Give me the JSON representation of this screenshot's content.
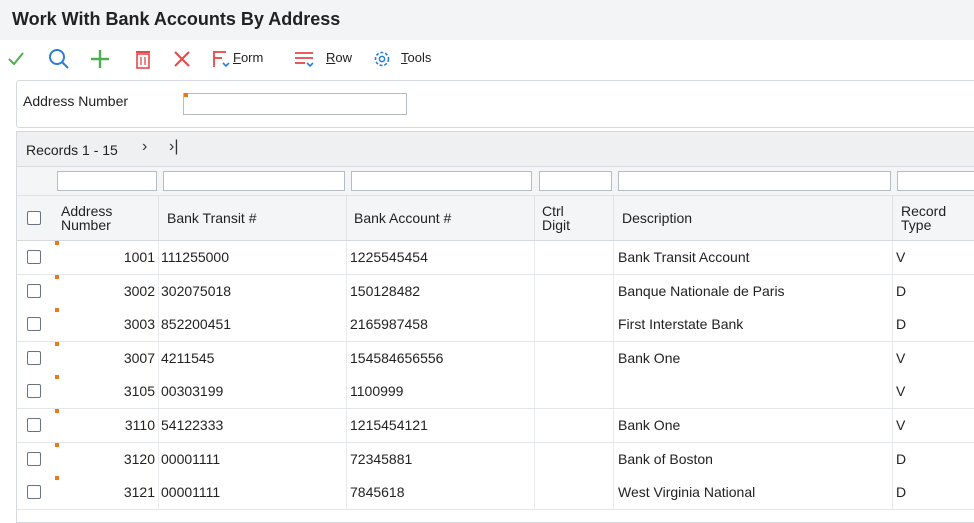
{
  "window": {
    "title": "Work With Bank Accounts By Address"
  },
  "toolbar": {
    "form_prefix": "",
    "form_hot": "F",
    "form_rest": "orm",
    "row_hot": "R",
    "row_rest": "ow",
    "tools_hot": "T",
    "tools_rest": "ools"
  },
  "query": {
    "address_number_label": "Address Number",
    "address_number_value": ""
  },
  "grid": {
    "records_label": "Records 1 - 15",
    "columns": [
      {
        "label_line1": "Address",
        "label_line2": "Number"
      },
      {
        "label_line1": "Bank Transit #",
        "label_line2": ""
      },
      {
        "label_line1": "Bank Account #",
        "label_line2": ""
      },
      {
        "label_line1": "Ctrl",
        "label_line2": "Digit"
      },
      {
        "label_line1": "Description",
        "label_line2": ""
      },
      {
        "label_line1": "Record",
        "label_line2": "Type"
      }
    ],
    "rows": [
      {
        "address": "1001",
        "transit": "111255000",
        "account": "1225545454",
        "ctrl": "",
        "description": "Bank Transit Account",
        "type": "V"
      },
      {
        "address": "3002",
        "transit": "302075018",
        "account": "150128482",
        "ctrl": "",
        "description": "Banque Nationale de Paris",
        "type": "D"
      },
      {
        "address": "3003",
        "transit": "852200451",
        "account": "2165987458",
        "ctrl": "",
        "description": "First Interstate Bank",
        "type": "D"
      },
      {
        "address": "3007",
        "transit": "4211545",
        "account": "154584656556",
        "ctrl": "",
        "description": "Bank One",
        "type": "V"
      },
      {
        "address": "3105",
        "transit": "00303199",
        "account": "1100999",
        "ctrl": "",
        "description": "",
        "type": "V"
      },
      {
        "address": "3110",
        "transit": "54122333",
        "account": "1215454121",
        "ctrl": "",
        "description": "Bank One",
        "type": "V"
      },
      {
        "address": "3120",
        "transit": "00001111",
        "account": "72345881",
        "ctrl": "",
        "description": "Bank of Boston",
        "type": "D"
      },
      {
        "address": "3121",
        "transit": "00001111",
        "account": "7845618",
        "ctrl": "",
        "description": "West Virginia National",
        "type": "D"
      }
    ]
  },
  "icons": {
    "select": "check-icon",
    "find": "search-icon",
    "add": "plus-icon",
    "delete": "trash-icon",
    "close": "close-icon",
    "form": "form-menu-icon",
    "row": "row-menu-icon",
    "tools": "gear-icon"
  },
  "colors": {
    "check": "#4caf50",
    "blue": "#2a7fd4",
    "red": "#e54848",
    "required": "#e87a1d"
  }
}
